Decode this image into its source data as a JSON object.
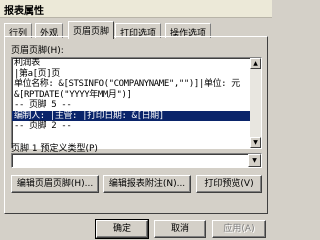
{
  "window": {
    "title": "报表属性"
  },
  "tabs": [
    {
      "label": "行列",
      "active": false
    },
    {
      "label": "外观",
      "active": false
    },
    {
      "label": "页眉页脚",
      "active": true
    },
    {
      "label": "打印选项",
      "active": false
    },
    {
      "label": "操作选项",
      "active": false
    }
  ],
  "header_footer": {
    "label": "页眉页脚(H):",
    "lines": [
      "利润表",
      "|第a[页]页",
      "单位名称: &[STSINFO(\"COMPANYNAME\",\"\")]|单位: 元",
      "&[RPTDATE(\"YYYY年MM月\")]",
      "-- 页脚 5 --",
      "编制人: |主管: |打印日期: &[日期]",
      "-- 页脚 2 --"
    ],
    "selected_index": 5
  },
  "predefined": {
    "label": "页脚 1 预定义类型(P)",
    "value": ""
  },
  "action_buttons": {
    "edit_header_footer": "编辑页眉页脚(H)...",
    "edit_report_note": "编辑报表附注(N)...",
    "print_preview": "打印预览(V)"
  },
  "dialog_buttons": {
    "ok": "确定",
    "cancel": "取消",
    "apply": "应用(A)"
  },
  "colors": {
    "selection": "#0a246a",
    "face": "#d4d0c8"
  }
}
